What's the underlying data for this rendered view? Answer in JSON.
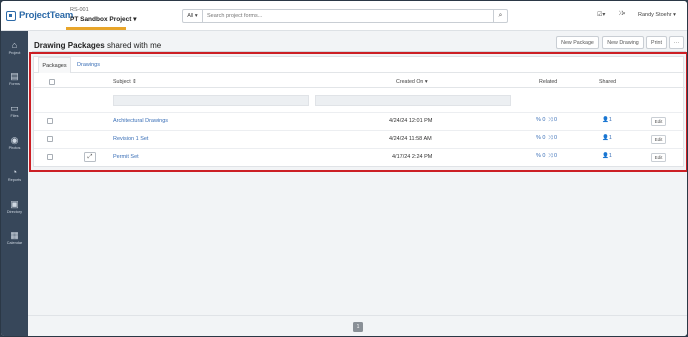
{
  "app": {
    "logo": "ProjectTeam"
  },
  "project": {
    "code": "RS-001",
    "name": "PT Sandbox Project"
  },
  "search": {
    "scope": "All",
    "placeholder": "Search project forms..."
  },
  "user": {
    "name": "Randy Stoehr"
  },
  "sidebar": {
    "items": [
      {
        "label": "Project",
        "icon": "home-icon",
        "glyph": "⌂"
      },
      {
        "label": "Forms",
        "icon": "document-icon",
        "glyph": "▤"
      },
      {
        "label": "Files",
        "icon": "folder-icon",
        "glyph": "▭"
      },
      {
        "label": "Photos",
        "icon": "camera-icon",
        "glyph": "◉"
      },
      {
        "label": "Reports",
        "icon": "dashboard-icon",
        "glyph": "◔"
      },
      {
        "label": "Directory",
        "icon": "address-book-icon",
        "glyph": "▣"
      },
      {
        "label": "Calendar",
        "icon": "calendar-icon",
        "glyph": "▦"
      }
    ]
  },
  "page": {
    "title_bold": "Drawing Packages",
    "title_rest": "shared with me"
  },
  "toolbar": {
    "new_package": "New Package",
    "new_drawing": "New Drawing",
    "print": "Print",
    "more": "···"
  },
  "tabs": [
    {
      "label": "Packages"
    },
    {
      "label": "Drawings"
    }
  ],
  "table": {
    "columns": {
      "subject": "Subject",
      "created_on": "Created On",
      "related": "Related",
      "shared": "Shared"
    },
    "rows": [
      {
        "subject": "Architectural Drawings",
        "created": "4/24/24 12:01 PM",
        "links": "0",
        "related": "0",
        "shared": "1",
        "edit": "Edit"
      },
      {
        "subject": "Revision 1 Set",
        "created": "4/24/24 11:58 AM",
        "links": "0",
        "related": "0",
        "shared": "1",
        "edit": "Edit"
      },
      {
        "subject": "Permit Set",
        "created": "4/17/24 2:24 PM",
        "links": "0",
        "related": "0",
        "shared": "1",
        "edit": "Edit"
      }
    ]
  },
  "pagination": {
    "page": "1"
  },
  "colors": {
    "accent": "#3a6fb7",
    "highlight": "#cc1f25",
    "sidebar": "#37475a",
    "brand_underline": "#e8a52a"
  }
}
